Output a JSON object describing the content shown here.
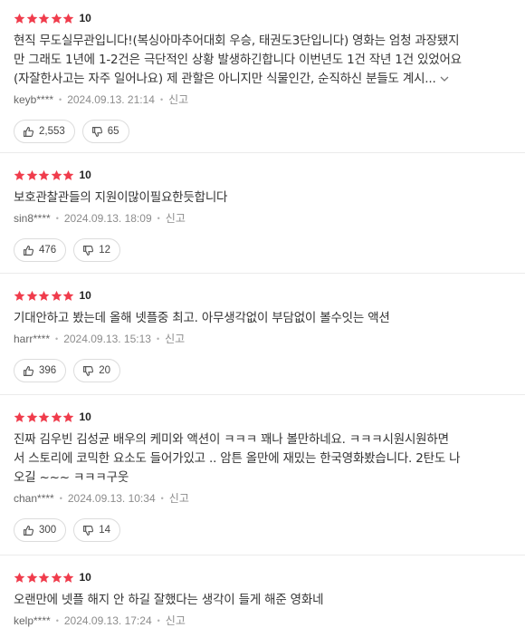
{
  "reviews": [
    {
      "score": "10",
      "lines": [
        "현직 무도실무관입니다!(복싱아마추어대회 우승, 태권도3단입니다) 영화는 엄청 과장됐지",
        "만 그래도 1년에 1-2건은 극단적인 상황 발생하긴합니다 이번년도 1건 작년 1건 있었어요",
        "(자잘한사고는 자주 일어나요) 제 관할은 아니지만 식물인간, 순직하신 분들도 계시..."
      ],
      "user": "keyb****",
      "date": "2024.09.13. 21:14",
      "report": "신고",
      "likes": "2,553",
      "dislikes": "65"
    },
    {
      "score": "10",
      "lines": [
        "보호관찰관들의 지원이많이필요한듯합니다"
      ],
      "user": "sin8****",
      "date": "2024.09.13. 18:09",
      "report": "신고",
      "likes": "476",
      "dislikes": "12"
    },
    {
      "score": "10",
      "lines": [
        "기대안하고 봤는데 올해 넷플중 최고. 아무생각없이 부담없이 볼수잇는 액션"
      ],
      "user": "harr****",
      "date": "2024.09.13. 15:13",
      "report": "신고",
      "likes": "396",
      "dislikes": "20"
    },
    {
      "score": "10",
      "lines": [
        "진짜 김우빈 김성균 배우의 케미와 액션이 ㅋㅋㅋ 꽤나 볼만하네요. ㅋㅋㅋ시원시원하면",
        "서 스토리에 코믹한 요소도 들어가있고 .. 암튼 올만에 재밌는 한국영화봤습니다. 2탄도 나",
        "오길 ~~~ ㅋㅋㅋ구웃"
      ],
      "user": "chan****",
      "date": "2024.09.13. 10:34",
      "report": "신고",
      "likes": "300",
      "dislikes": "14"
    },
    {
      "score": "10",
      "lines": [
        "오랜만에 넷플 해지 안 하길 잘했다는 생각이 들게 해준 영화네"
      ],
      "user": "kelp****",
      "date": "2024.09.13. 17:24",
      "report": "신고"
    }
  ],
  "colors": {
    "star": "#f03c4c",
    "meta": "#8c8c8c",
    "border": "#dcdcdc"
  },
  "icons": {
    "like": "thumbs-up-icon",
    "dislike": "thumbs-down-icon",
    "more": "chevron-down-icon",
    "star": "star-icon"
  }
}
